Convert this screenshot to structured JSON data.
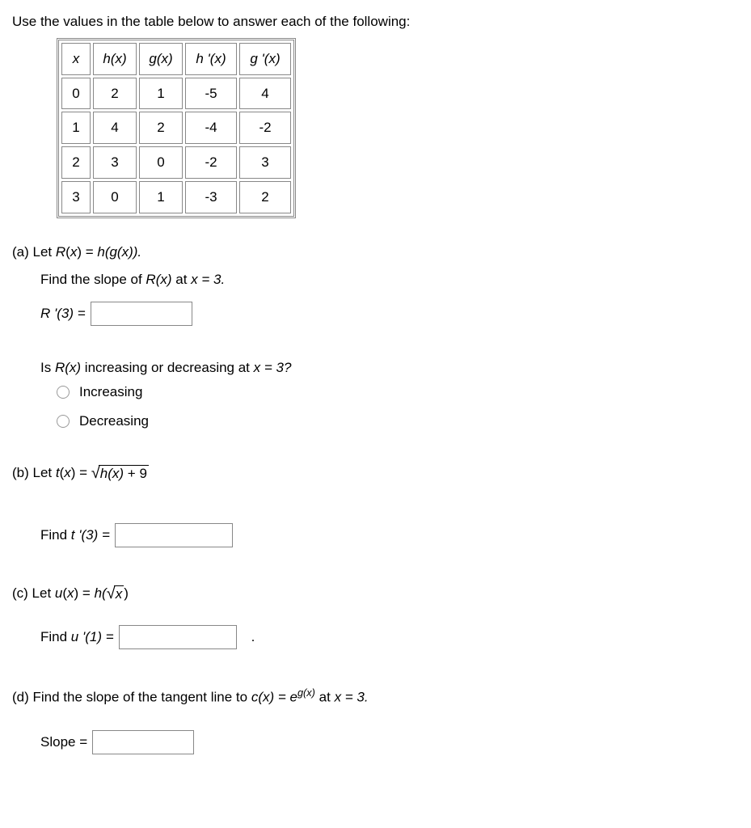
{
  "intro": "Use the values in the table below to answer each of the following:",
  "table": {
    "headers": [
      "x",
      "h(x)",
      "g(x)",
      "h '(x)",
      "g '(x)"
    ],
    "rows": [
      [
        "0",
        "2",
        "1",
        "-5",
        "4"
      ],
      [
        "1",
        "4",
        "2",
        "-4",
        "-2"
      ],
      [
        "2",
        "3",
        "0",
        "-2",
        "3"
      ],
      [
        "3",
        "0",
        "1",
        "-3",
        "2"
      ]
    ]
  },
  "a": {
    "label": "(a) Let ",
    "def_var": "R",
    "def_rhs": "h(g(x)).",
    "prompt": "Find the slope of ",
    "prompt_at": " at ",
    "point": "x = 3.",
    "answer_label": "R '(3) =",
    "inc_prompt_pre": "Is ",
    "inc_prompt_post": " increasing or decreasing at ",
    "inc_point": "x = 3?",
    "opt_increasing": "Increasing",
    "opt_decreasing": "Decreasing"
  },
  "b": {
    "label": "(b) Let  ",
    "def_var": "t",
    "sqrt_inner_pre": "h(x)",
    "sqrt_inner_post": " + 9",
    "find_label": "Find ",
    "answer_label": "t '(3) ="
  },
  "c": {
    "label": "(c) Let  ",
    "def_var": "u",
    "sqrt_inner": "x",
    "outer": "h(",
    "outer_close": ")",
    "find_label": "Find ",
    "answer_label": "u '(1) =",
    "trailing": "."
  },
  "d": {
    "label": "(d) Find the slope of the tangent line to  ",
    "cx": "c(x) = e",
    "exp": "g(x)",
    "at": "  at ",
    "point": "x = 3.",
    "answer_label": "Slope ="
  }
}
